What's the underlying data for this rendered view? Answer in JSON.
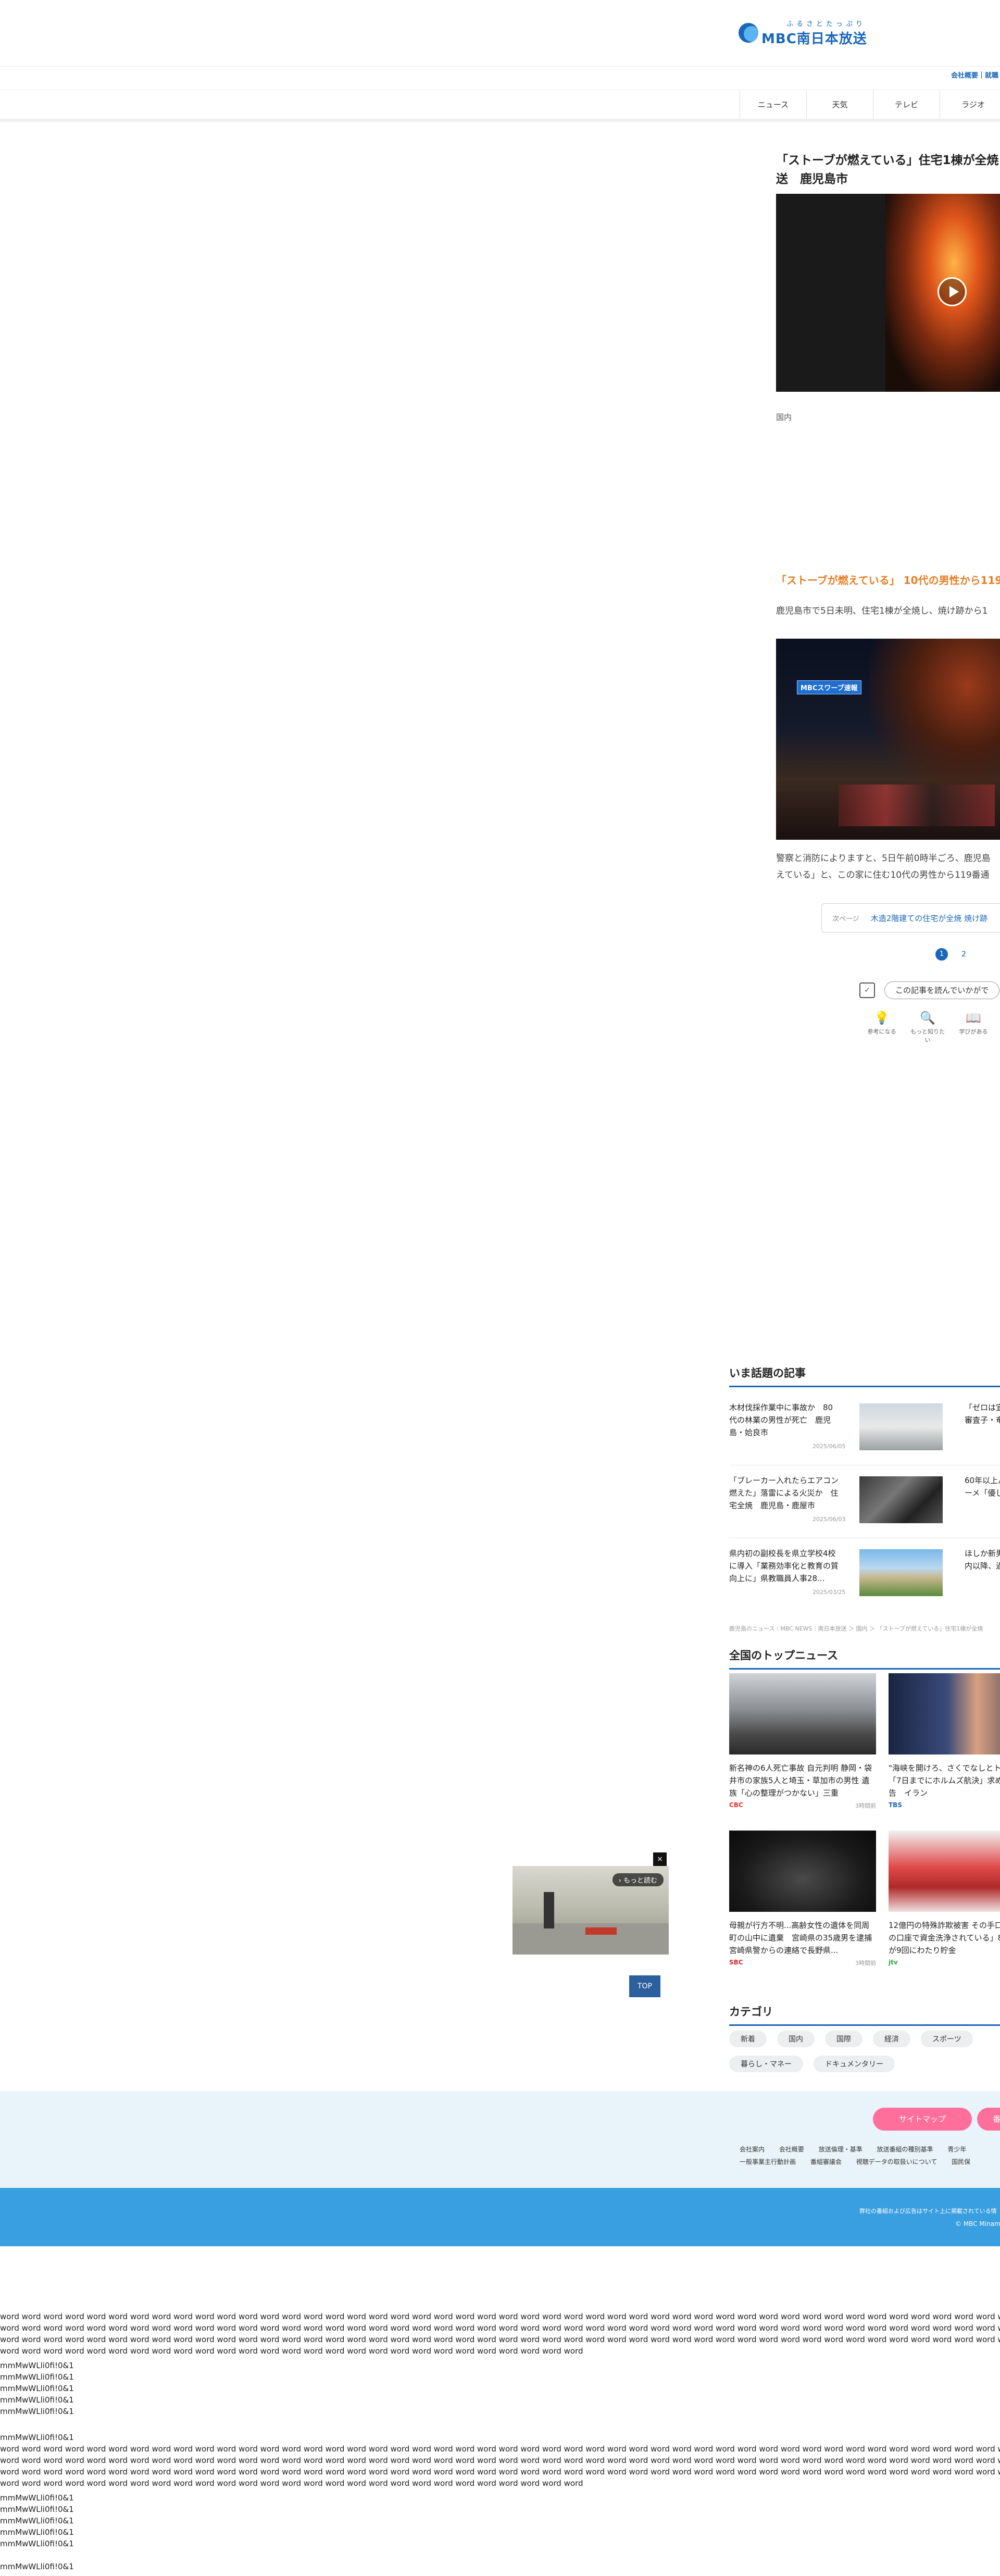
{
  "header": {
    "logo_ruby": "ふるさとたっぷり",
    "logo_name": "MBC南日本放送",
    "corp_link": "会社概要｜就職"
  },
  "nav": [
    "ニュース",
    "天気",
    "テレビ",
    "ラジオ"
  ],
  "article": {
    "title": "「ストーブが燃えている」住宅1棟が全焼 送　鹿児島市",
    "category": "国内",
    "subhead": "「ストーブが燃えている」 10代の男性から119",
    "lead": "鹿児島市で5日未明、住宅1棟が全焼し、焼け跡から1",
    "badge": "MBCスワーブ速報",
    "body_lines": [
      "警察と消防によりますと、5日午前0時半ごろ、鹿児島",
      "えている」と、この家に住む10代の男性から119番通"
    ],
    "next_page_label": "次ページ",
    "next_page_text": "木造2階建ての住宅が全焼 焼け跡",
    "pager": [
      "1",
      "2"
    ],
    "survey_icon": "✓",
    "survey_button": "この記事を読んでいかがで",
    "reactions": [
      {
        "icon": "lightbulb-icon",
        "glyph": "💡",
        "label": "参考になる"
      },
      {
        "icon": "magnifier-icon",
        "glyph": "🔍",
        "label": "もっと知りたい"
      },
      {
        "icon": "book-icon",
        "glyph": "📖",
        "label": "学びがある"
      }
    ]
  },
  "trending": {
    "heading": "いま話題の記事",
    "items": [
      {
        "title": "木材伐採作業中に事故か　80代の林業の男性が死亡　鹿児島・姶良市",
        "date": "2025/06/05"
      },
      {
        "title": "「ブレーカー入れたらエアコン燃えた」落雷による火災か　住宅全焼　鹿児島・鹿屋市",
        "date": "2025/06/03"
      },
      {
        "title": "県内初の副校長を県立学校4校に導入「業務効率化と教育の質向上に」県教職員人事28...",
        "date": "2025/03/25"
      }
    ],
    "right_items": [
      "「ゼロは宜試二次審査子・奄美市",
      "60年以上んやラーメ「優しい味",
      "ほしか新男性　県内以降、過去"
    ]
  },
  "breadcrumb": "鹿児島のニュース｜MBC NEWS｜南日本放送 ＞ 国内 ＞ 「ストーブが燃えている」住宅1棟が全焼",
  "top_news": {
    "heading": "全国のトップニュース",
    "cards": [
      {
        "title": "新名神の6人死亡事故 自元判明 静岡・袋井市の家族5人と埼玉・草加市の男性 遺族「心の整理がつかない」三重",
        "source": "CBC",
        "src_color": "#e8302a",
        "date": "3時間前"
      },
      {
        "title": "\"海峡を開けろ、さくでなしとトランプ氏「7日までにホルムズ航決」求め攻撃の警告　イラン",
        "source": "TBS",
        "src_color": "#1a66b8",
        "date": ""
      },
      {
        "title": "母親が行方不明...高齢女性の遺体を同周町の山中に遺棄　宮崎県の35歳男を逮捕　宮崎県警からの連絡で長野県...",
        "source": "SBC",
        "src_color": "#d62a2a",
        "date": "3時間前"
      },
      {
        "title": "12億円の特殊詐欺被害 その手口「あなたの口座で資金洗浄されている」80代女性が9回にわたり貯金",
        "source": "jtv",
        "src_color": "#2aa84a",
        "date": ""
      }
    ]
  },
  "float_ad": {
    "more_label": "› もっと読む",
    "close_label": "×"
  },
  "top_button": "TOP",
  "category": {
    "heading": "カテゴリ",
    "chips": [
      "新着",
      "国内",
      "国際",
      "経済",
      "スポーツ",
      "暮らし・マネー",
      "ドキュメンタリー"
    ]
  },
  "footer": {
    "sitemap": "サイトマップ",
    "program": "番組",
    "links_row1": [
      "会社案内",
      "会社概要",
      "放送倫理・基準",
      "放送番組の種別基準",
      "青少年"
    ],
    "links_row2": [
      "一般事業主行動計画",
      "番組審議会",
      "視聴データの取扱いについて",
      "国民保"
    ],
    "copy_line1": "弊社の番組および広告はサイト上に掲載されている情",
    "copy_line2": "© MBC Minami"
  },
  "debug": {
    "word_line": "word word word word word word word word word word word word word word word word word word word word word word word word word word word word word word word word word word word word word word word word word word word word word word word word word word word word word word word word word word word word word word word word word word word word word word word word word word word word word word word word word word word word word word word word word word word word",
    "word_short": "word word word word word word word word word word word word word word word word word word word word word word word word word word word",
    "glyph_a": "mmMwWLli0fi!0&1",
    "glyph_b": "mmMwWLli0fi!0&1",
    "glyph_c": "mmMwWLli0fi!0&1",
    "glyph_d": "mmMwWLli0fi!0&1",
    "glyph_e": "mmMwWLli0fi!0&1",
    "glyph_f": "mmMwWLli0fi!0&1"
  }
}
